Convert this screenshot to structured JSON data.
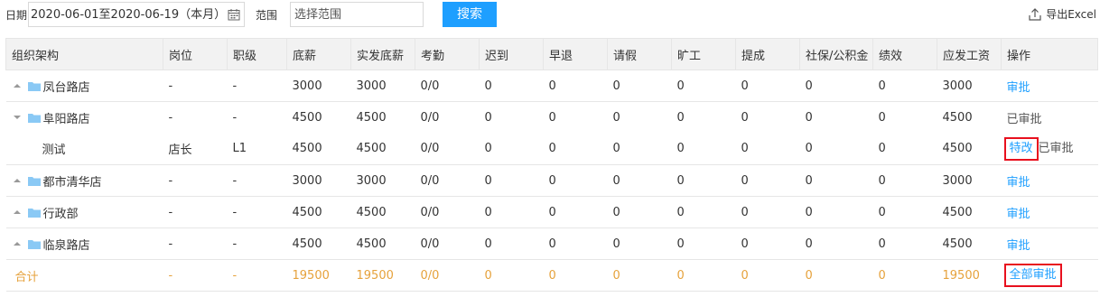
{
  "filters": {
    "date_label": "日期",
    "date_value": "2020-06-01至2020-06-19（本月）",
    "range_label": "范围",
    "range_placeholder": "选择范围",
    "search_button": "搜索",
    "export_label": "导出Excel"
  },
  "table": {
    "headers": [
      "组织架构",
      "岗位",
      "职级",
      "底薪",
      "实发底薪",
      "考勤",
      "迟到",
      "早退",
      "请假",
      "旷工",
      "提成",
      "社保/公积金",
      "绩效",
      "应发工资",
      "操作"
    ],
    "rows": [
      {
        "org": "凤台路店",
        "post": "-",
        "level": "-",
        "base": "3000",
        "actual_base": "3000",
        "attendance": "0/0",
        "late": "0",
        "early": "0",
        "leave": "0",
        "absent": "0",
        "commission": "0",
        "insurance": "0",
        "performance": "0",
        "payable": "3000",
        "action": "审批"
      },
      {
        "org": "阜阳路店",
        "post": "-",
        "level": "-",
        "base": "4500",
        "actual_base": "4500",
        "attendance": "0/0",
        "late": "0",
        "early": "0",
        "leave": "0",
        "absent": "0",
        "commission": "0",
        "insurance": "0",
        "performance": "0",
        "payable": "4500",
        "action": "已审批"
      },
      {
        "org": "测试",
        "post": "店长",
        "level": "L1",
        "base": "4500",
        "actual_base": "4500",
        "attendance": "0/0",
        "late": "0",
        "early": "0",
        "leave": "0",
        "absent": "0",
        "commission": "0",
        "insurance": "0",
        "performance": "0",
        "payable": "4500",
        "action_link": "特改",
        "action_status": "已审批"
      },
      {
        "org": "都市清华店",
        "post": "-",
        "level": "-",
        "base": "3000",
        "actual_base": "3000",
        "attendance": "0/0",
        "late": "0",
        "early": "0",
        "leave": "0",
        "absent": "0",
        "commission": "0",
        "insurance": "0",
        "performance": "0",
        "payable": "3000",
        "action": "审批"
      },
      {
        "org": "行政部",
        "post": "-",
        "level": "-",
        "base": "4500",
        "actual_base": "4500",
        "attendance": "0/0",
        "late": "0",
        "early": "0",
        "leave": "0",
        "absent": "0",
        "commission": "0",
        "insurance": "0",
        "performance": "0",
        "payable": "4500",
        "action": "审批"
      },
      {
        "org": "临泉路店",
        "post": "-",
        "level": "-",
        "base": "4500",
        "actual_base": "4500",
        "attendance": "0/0",
        "late": "0",
        "early": "0",
        "leave": "0",
        "absent": "0",
        "commission": "0",
        "insurance": "0",
        "performance": "0",
        "payable": "4500",
        "action": "审批"
      }
    ],
    "total": {
      "label": "合计",
      "post": "-",
      "level": "-",
      "base": "19500",
      "actual_base": "19500",
      "attendance": "0/0",
      "late": "0",
      "early": "0",
      "leave": "0",
      "absent": "0",
      "commission": "0",
      "insurance": "0",
      "performance": "0",
      "payable": "19500",
      "action": "全部审批"
    }
  },
  "icons": {
    "calendar": "calendar-icon",
    "export": "export-icon",
    "folder": "folder-icon",
    "collapse_arrow": "triangle-up-icon",
    "expand_arrow": "triangle-down-icon"
  },
  "colors": {
    "accent": "#1e9fff",
    "total_text": "#e6a23c",
    "highlight_box": "#e8101e",
    "folder": "#8ac9f5",
    "header_bg": "#f2f2f2"
  }
}
